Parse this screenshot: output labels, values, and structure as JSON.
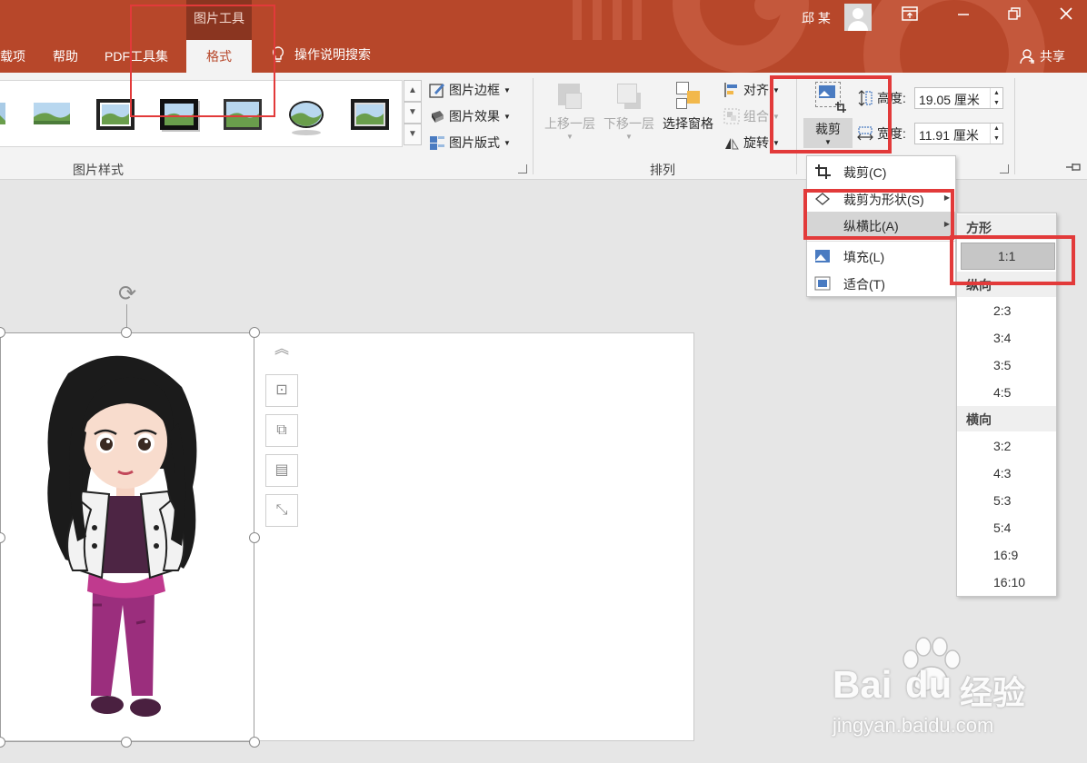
{
  "titlebar": {
    "context_tool": "图片工具",
    "user_name": "邱 某",
    "window_buttons": [
      "ribbon-display-icon",
      "minimize-icon",
      "restore-icon",
      "close-icon"
    ]
  },
  "tabs": [
    {
      "label": "载项"
    },
    {
      "label": "帮助"
    },
    {
      "label": "PDF工具集"
    },
    {
      "label": "格式",
      "active": true
    }
  ],
  "tell_me": "操作说明搜索",
  "share": "共享",
  "ribbon": {
    "picture_styles": {
      "label": "图片样式",
      "border_label": "图片边框",
      "effects_label": "图片效果",
      "layout_label": "图片版式"
    },
    "arrange": {
      "label": "排列",
      "bring_forward_label": "上移一层",
      "send_backward_label": "下移一层",
      "selection_pane_label": "选择窗格",
      "align_label": "对齐",
      "group_label": "组合",
      "rotate_label": "旋转"
    },
    "size": {
      "crop_label": "裁剪",
      "height_label": "高度:",
      "height_value": "19.05 厘米",
      "width_label": "宽度:",
      "width_value": "11.91 厘米"
    }
  },
  "crop_menu": {
    "items": [
      {
        "label": "裁剪(C)",
        "icon": "crop-icon"
      },
      {
        "label": "裁剪为形状(S)",
        "icon": "shape-crop-icon",
        "submenu": true
      },
      {
        "label": "纵横比(A)",
        "submenu": true,
        "hover": true
      },
      {
        "label": "填充(L)",
        "icon": "fill-icon"
      },
      {
        "label": "适合(T)",
        "icon": "fit-icon"
      }
    ]
  },
  "aspect_submenu": {
    "sections": [
      {
        "header": "方形",
        "items": [
          "1:1"
        ]
      },
      {
        "header": "纵向",
        "items": [
          "2:3",
          "3:4",
          "3:5",
          "4:5"
        ]
      },
      {
        "header": "横向",
        "items": [
          "3:2",
          "4:3",
          "5:3",
          "5:4",
          "16:9",
          "16:10"
        ]
      }
    ],
    "selected": "1:1"
  },
  "float_tools": [
    "collapse-up-icon",
    "layout-options-icon",
    "bring-front-icon",
    "wrap-text-icon",
    "resize-icon"
  ],
  "watermark": {
    "logo_text": "Bai",
    "logo_text_2": "du",
    "site_cn": "经验",
    "url": "jingyan.baidu.com"
  },
  "colors": {
    "accent": "#b7472a",
    "annotation": "#e23a3a"
  }
}
